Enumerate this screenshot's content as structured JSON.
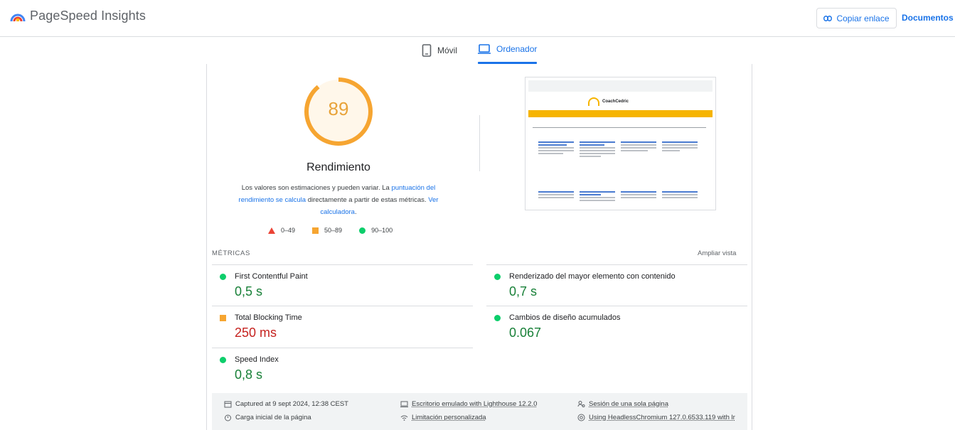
{
  "header": {
    "title": "PageSpeed Insights",
    "copy_label": "Copiar enlace",
    "docs_label": "Documentos"
  },
  "tabs": [
    {
      "label": "Móvil",
      "active": false
    },
    {
      "label": "Ordenador",
      "active": true
    }
  ],
  "performance": {
    "score": "89",
    "score_color": "#e8a33a",
    "title": "Rendimiento",
    "desc_prefix": "Los valores son estimaciones y pueden variar. La ",
    "desc_link": "puntuación del rendimiento se calcula",
    "desc_middle": " directamente a partir de estas métricas. ",
    "desc_link2": "Ver calculadora",
    "desc_suffix": ".",
    "legend": [
      {
        "range": "0–49",
        "shape": "triangle",
        "color": "#eb4335"
      },
      {
        "range": "50–89",
        "shape": "square",
        "color": "#f6a531"
      },
      {
        "range": "90–100",
        "shape": "circle",
        "color": "#0cce6b"
      }
    ]
  },
  "thumbnail": {
    "site_name": "CoachCedric"
  },
  "metrics": {
    "section_label": "MÉTRICAS",
    "expand_label": "Ampliar vista",
    "items": [
      {
        "name": "First Contentful Paint",
        "value": "0,5 s",
        "status": "good"
      },
      {
        "name": "Renderizado del mayor elemento con contenido",
        "value": "0,7 s",
        "status": "good"
      },
      {
        "name": "Total Blocking Time",
        "value": "250 ms",
        "status": "average"
      },
      {
        "name": "Cambios de diseño acumulados",
        "value": "0.067",
        "status": "good"
      },
      {
        "name": "Speed Index",
        "value": "0,8 s",
        "status": "good"
      }
    ]
  },
  "footer": {
    "captured": "Captured at 9 sept 2024, 12:38 CEST",
    "emulated": "Escritorio emulado with Lighthouse 12.2.0",
    "session": "Sesión de una sola página",
    "load": "Carga inicial de la página",
    "throttling": "Limitación personalizada",
    "browser": "Using HeadlessChromium 127.0.6533.119 with lr"
  }
}
